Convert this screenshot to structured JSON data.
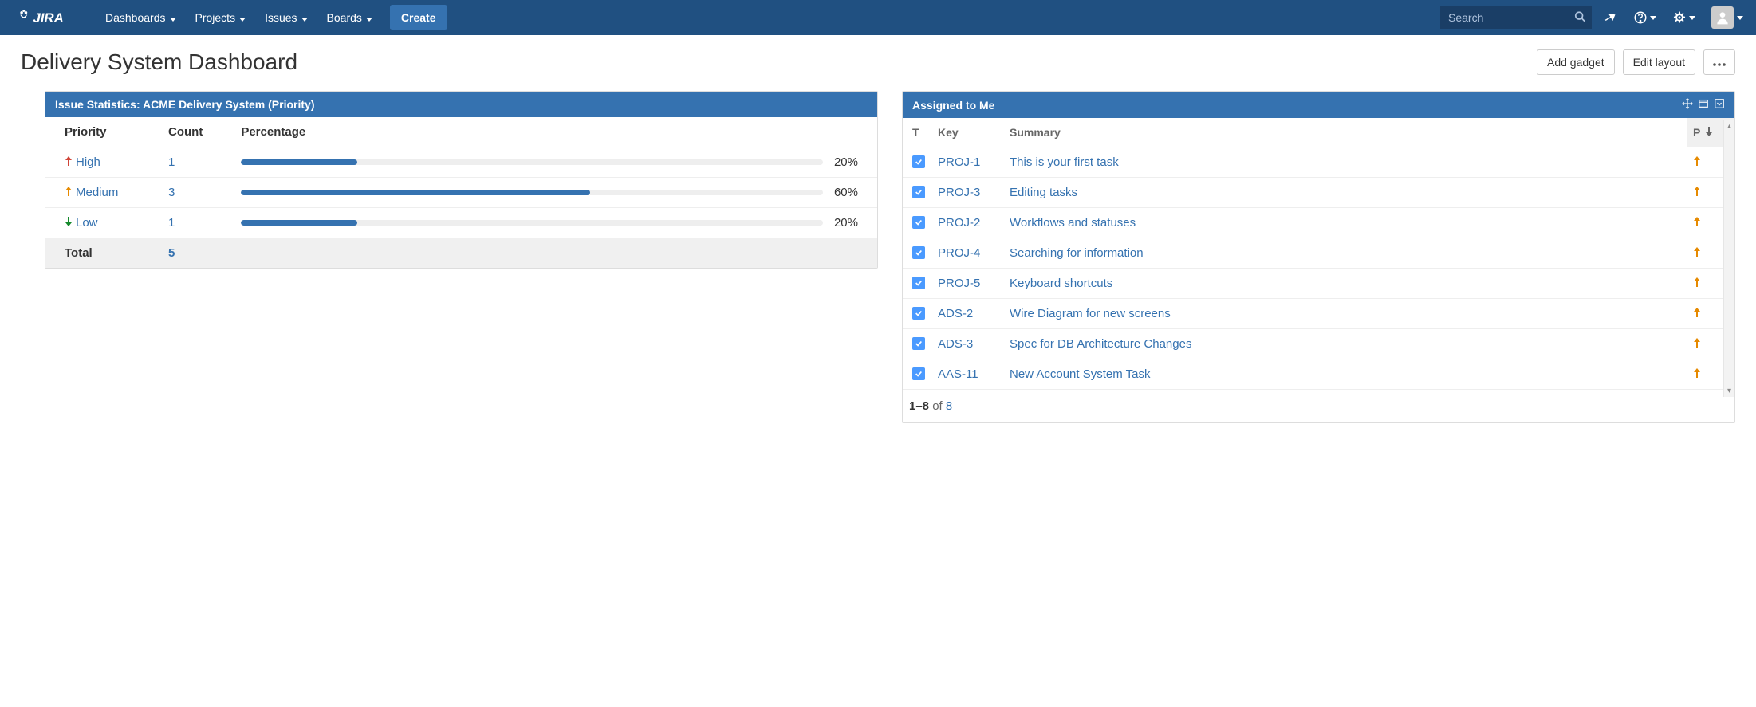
{
  "nav": {
    "logo_text": "JIRA",
    "items": [
      "Dashboards",
      "Projects",
      "Issues",
      "Boards"
    ],
    "create_label": "Create",
    "search_placeholder": "Search"
  },
  "page": {
    "title": "Delivery System Dashboard",
    "add_gadget": "Add gadget",
    "edit_layout": "Edit layout"
  },
  "stats_gadget": {
    "title": "Issue Statistics: ACME Delivery System (Priority)",
    "headers": {
      "priority": "Priority",
      "count": "Count",
      "percentage": "Percentage"
    },
    "rows": [
      {
        "priority": "High",
        "priority_color": "#d04437",
        "arrow": "up",
        "count": "1",
        "pct_label": "20%",
        "pct": 20
      },
      {
        "priority": "Medium",
        "priority_color": "#e68a00",
        "arrow": "up",
        "count": "3",
        "pct_label": "60%",
        "pct": 60
      },
      {
        "priority": "Low",
        "priority_color": "#14892c",
        "arrow": "down",
        "count": "1",
        "pct_label": "20%",
        "pct": 20
      }
    ],
    "total_label": "Total",
    "total_count": "5"
  },
  "assigned_gadget": {
    "title": "Assigned to Me",
    "headers": {
      "type": "T",
      "key": "Key",
      "summary": "Summary",
      "priority": "P"
    },
    "rows": [
      {
        "key": "PROJ-1",
        "summary": "This is your first task"
      },
      {
        "key": "PROJ-3",
        "summary": "Editing tasks"
      },
      {
        "key": "PROJ-2",
        "summary": "Workflows and statuses"
      },
      {
        "key": "PROJ-4",
        "summary": "Searching for information"
      },
      {
        "key": "PROJ-5",
        "summary": "Keyboard shortcuts"
      },
      {
        "key": "ADS-2",
        "summary": "Wire Diagram for new screens"
      },
      {
        "key": "ADS-3",
        "summary": "Spec for DB Architecture Changes"
      },
      {
        "key": "AAS-11",
        "summary": "New Account System Task"
      }
    ],
    "pager": {
      "range": "1–8",
      "of": " of ",
      "total": "8"
    }
  },
  "chart_data": {
    "type": "bar",
    "title": "Issue Statistics: ACME Delivery System (Priority)",
    "categories": [
      "High",
      "Medium",
      "Low"
    ],
    "values": [
      1,
      3,
      1
    ],
    "percentages": [
      20,
      60,
      20
    ],
    "total": 5,
    "xlabel": "Priority",
    "ylabel": "Count"
  }
}
